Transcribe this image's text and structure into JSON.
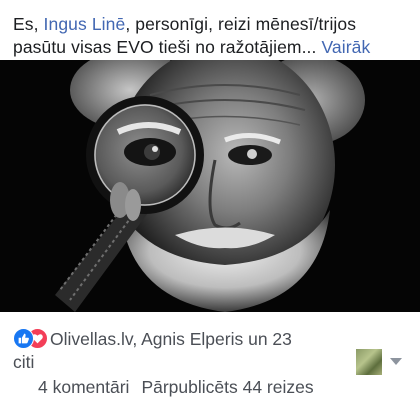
{
  "post": {
    "text_prefix": "Es, ",
    "mention": "Ingus Linē",
    "text_after_mention": ", personīgi, reizi mēnesī/trijos",
    "text_line2": "pasūtu visas EVO tieši no ražotājiem...",
    "more_link": "Vairāk"
  },
  "reactions": {
    "icons": [
      "like-icon",
      "love-icon"
    ],
    "colors": {
      "like": "#1877f2",
      "love": "#f33e58"
    },
    "names_line1": "Olivellas.lv, Agnis Elperis un 23",
    "names_line2": "citi"
  },
  "stats": {
    "comments": "4 komentāri",
    "shares": "Pārpublicēts 44 reizes"
  },
  "accent_color": "#4267b2"
}
